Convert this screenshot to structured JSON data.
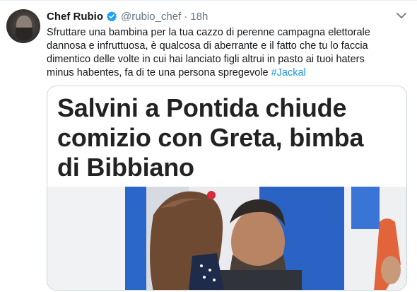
{
  "tweet": {
    "author": {
      "name": "Chef Rubio",
      "handle": "@rubio_chef",
      "separator": "·",
      "time": "18h",
      "verified_icon": "verified-badge-icon",
      "verified_color": "#1da1f2"
    },
    "text_lines": [
      "Sfruttare una bambina per la tua cazzo di perenne campagna elettorale",
      "dannosa e infruttuosa, è qualcosa di aberrante e il fatto che tu  lo faccia",
      "dimentico delle volte in cui hai lanciato figli altrui in pasto ai tuoi haters",
      "minus habentes, fa di te una persona spregevole "
    ],
    "hashtag": "#Jackal",
    "hashtag_color": "#1b95e0",
    "menu_icon": "chevron-down-icon"
  },
  "card": {
    "headline_lines": [
      "Salvini a Pontida chiude",
      "comizio con Greta, bimba",
      "di Bibbiano"
    ]
  }
}
